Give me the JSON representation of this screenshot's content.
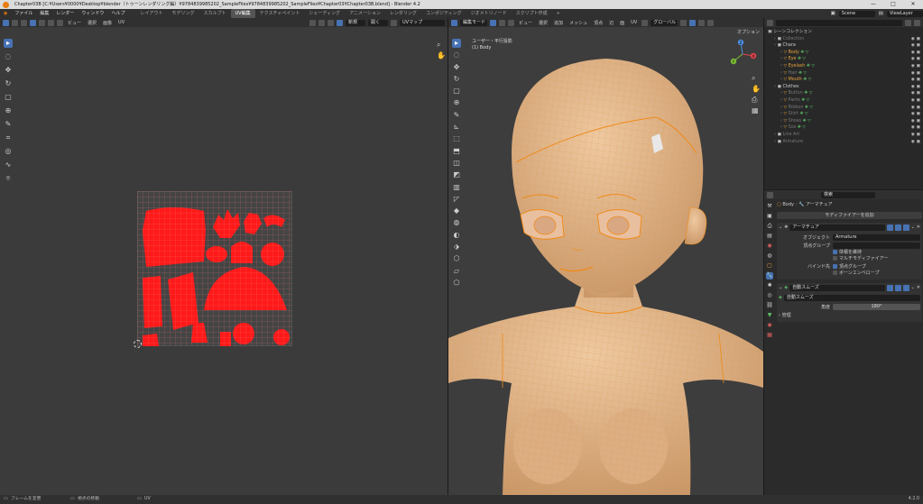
{
  "window": {
    "title": "Chapter03B [C:¥Users¥0000¥Desktop¥blender（トゥーンレンダリング編）¥9784839985202_SampleFiles¥9784839985202_SampleFiles¥Chapter03¥Chapter03B.blend] - Blender 4.2",
    "minimize": "—",
    "maximize": "□",
    "close": "✕"
  },
  "menubar": {
    "menus": [
      "ファイル",
      "編集",
      "レンダー",
      "ウィンドウ",
      "ヘルプ"
    ],
    "workspaces": [
      "レイアウト",
      "モデリング",
      "スカルプト",
      "UV編集",
      "テクスチャペイント",
      "シェーディング",
      "アニメーション",
      "レンダリング",
      "コンポジティング",
      "ジオメトリノード",
      "スクリプト作成"
    ],
    "active_workspace": "UV編集",
    "add_tab": "+",
    "scene": "Scene",
    "view_layer": "ViewLayer"
  },
  "uv_editor": {
    "header_menus": [
      "ビュー",
      "選択",
      "画像",
      "UV"
    ],
    "image_name": "UVマップ",
    "new_button": "新規",
    "open_button": "開く"
  },
  "viewport": {
    "mode": "編集モード",
    "header_menus": [
      "ビュー",
      "選択",
      "追加",
      "メッシュ",
      "頂点",
      "辺",
      "面",
      "UV"
    ],
    "transform": "グローバル",
    "options_label": "オプション",
    "view_name": "ユーザー・平行投影",
    "object_info": "(1) Body",
    "axes": {
      "x": "X",
      "y": "Y",
      "z": "Z"
    }
  },
  "outliner": {
    "root": "シーンコレクション",
    "items": [
      {
        "name": "Collection",
        "indent": 1,
        "style": "dim"
      },
      {
        "name": "Chara",
        "indent": 1,
        "style": "normal"
      },
      {
        "name": "Body",
        "indent": 2,
        "style": "org"
      },
      {
        "name": "Eye",
        "indent": 2,
        "style": "org"
      },
      {
        "name": "Eyelash",
        "indent": 2,
        "style": "org"
      },
      {
        "name": "Hair",
        "indent": 2,
        "style": "dim"
      },
      {
        "name": "Mouth",
        "indent": 2,
        "style": "org"
      },
      {
        "name": "Clothes",
        "indent": 1,
        "style": "normal"
      },
      {
        "name": "Button",
        "indent": 2,
        "style": "dim"
      },
      {
        "name": "Pants",
        "indent": 2,
        "style": "dim"
      },
      {
        "name": "Ribbon",
        "indent": 2,
        "style": "dim"
      },
      {
        "name": "Shirt",
        "indent": 2,
        "style": "dim"
      },
      {
        "name": "Shoes",
        "indent": 2,
        "style": "dim"
      },
      {
        "name": "Sox",
        "indent": 2,
        "style": "dim"
      },
      {
        "name": "Line Art",
        "indent": 1,
        "style": "dim"
      },
      {
        "name": "Armature",
        "indent": 1,
        "style": "dim"
      }
    ]
  },
  "properties": {
    "search_placeholder": "検索",
    "breadcrumb_object": "Body",
    "breadcrumb_modifier": "アーマチュア",
    "add_modifier": "モディファイアーを追加",
    "armature_modifier": {
      "name": "アーマチュア",
      "object_label": "オブジェクト",
      "object_value": "Armature",
      "vertex_group_label": "頂点グループ",
      "preserve_volume": "体積を維持",
      "multi_modifier": "マルチモディファイアー",
      "bind_to_label": "バインド先",
      "bind_vertex_groups": "頂点グループ",
      "bind_bone_envelopes": "ボーンエンベロープ"
    },
    "smooth_modifier": {
      "name": "自動スムーズ",
      "node_group": "自動スムーズ",
      "angle_label": "角度",
      "angle_value": "180°",
      "manage": "管理"
    }
  },
  "statusbar": {
    "item1": "フレームを変更",
    "item2": "視点の移動",
    "item3": "UV",
    "version": "4.2.0"
  },
  "colors": {
    "accent": "#4772b3",
    "uv_wire": "#ff1a1a",
    "mesh_wire": "#f08a1a",
    "skin": "#e2b88c"
  }
}
